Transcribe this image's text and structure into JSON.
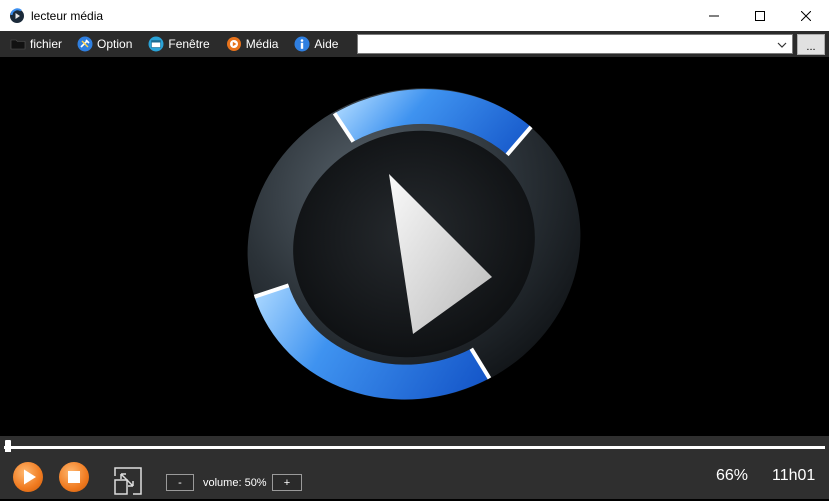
{
  "window": {
    "title": "lecteur média",
    "controls": [
      "minimize-icon",
      "maximize-icon",
      "close-icon"
    ]
  },
  "menu": {
    "items": [
      {
        "label": "fichier",
        "icon": "folder-icon"
      },
      {
        "label": "Option",
        "icon": "tools-icon"
      },
      {
        "label": "Fenêtre",
        "icon": "window-icon"
      },
      {
        "label": "Média",
        "icon": "media-icon"
      },
      {
        "label": "Aide",
        "icon": "info-icon"
      }
    ]
  },
  "toolbar": {
    "media_combo_value": "",
    "browse_label": "..."
  },
  "video": {
    "content": "media-player-logo"
  },
  "playback": {
    "progress": 0.0
  },
  "controls": {
    "volume_down_label": "-",
    "volume_up_label": "+",
    "volume_label": "volume: 50%",
    "zoom_percent": "66%",
    "time": "11h01"
  },
  "colors": {
    "accent": "#f07a1f",
    "menubar": "#2b2b2b",
    "controls_bg": "#2f2f2f",
    "logo_blue": "#2f7fe0"
  }
}
